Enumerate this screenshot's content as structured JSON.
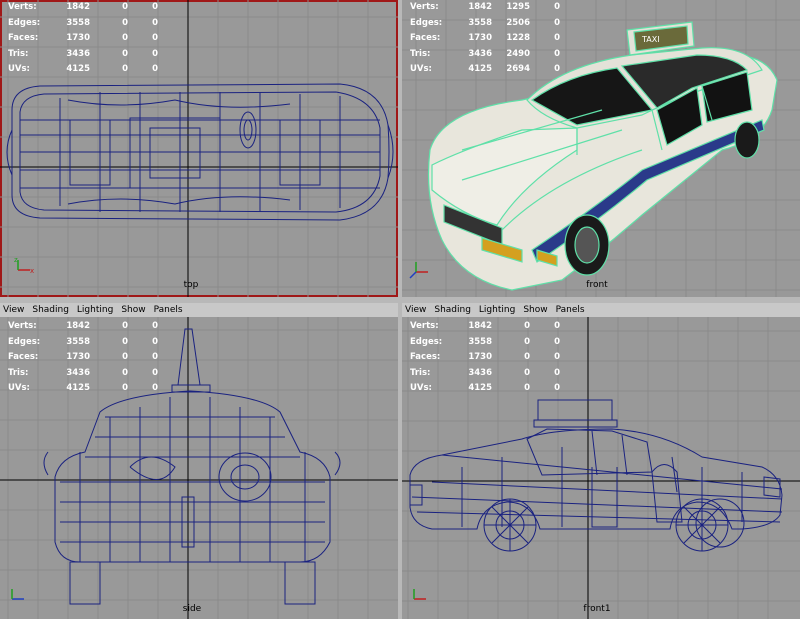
{
  "menu": [
    "View",
    "Shading",
    "Lighting",
    "Show",
    "Panels"
  ],
  "stat_labels": [
    "Verts:",
    "Edges:",
    "Faces:",
    "Tris:",
    "UVs:"
  ],
  "viewports": {
    "top": {
      "label": "top",
      "stats": [
        [
          "1842",
          "0",
          "0"
        ],
        [
          "3558",
          "0",
          "0"
        ],
        [
          "1730",
          "0",
          "0"
        ],
        [
          "3436",
          "0",
          "0"
        ],
        [
          "4125",
          "0",
          "0"
        ]
      ]
    },
    "front": {
      "label": "front",
      "stats": [
        [
          "1842",
          "1295",
          "0"
        ],
        [
          "3558",
          "2506",
          "0"
        ],
        [
          "1730",
          "1228",
          "0"
        ],
        [
          "3436",
          "2490",
          "0"
        ],
        [
          "4125",
          "2694",
          "0"
        ]
      ]
    },
    "side": {
      "label": "side",
      "stats": [
        [
          "1842",
          "0",
          "0"
        ],
        [
          "3558",
          "0",
          "0"
        ],
        [
          "1730",
          "0",
          "0"
        ],
        [
          "3436",
          "0",
          "0"
        ],
        [
          "4125",
          "0",
          "0"
        ]
      ]
    },
    "front1": {
      "label": "front1",
      "stats": [
        [
          "1842",
          "0",
          "0"
        ],
        [
          "3558",
          "0",
          "0"
        ],
        [
          "1730",
          "0",
          "0"
        ],
        [
          "3436",
          "0",
          "0"
        ],
        [
          "4125",
          "0",
          "0"
        ]
      ]
    }
  },
  "taxi_sign_text": "TAXI",
  "colors": {
    "viewport_bg": "#999999",
    "grid": "#8a8a8a",
    "axis": "#000000",
    "wire": "#1a2280",
    "active_border": "#a01818",
    "taxi_stripe": "#2a3a8a",
    "taxi_body": "#e8e6dc",
    "highlight": "#5fe0a8"
  }
}
